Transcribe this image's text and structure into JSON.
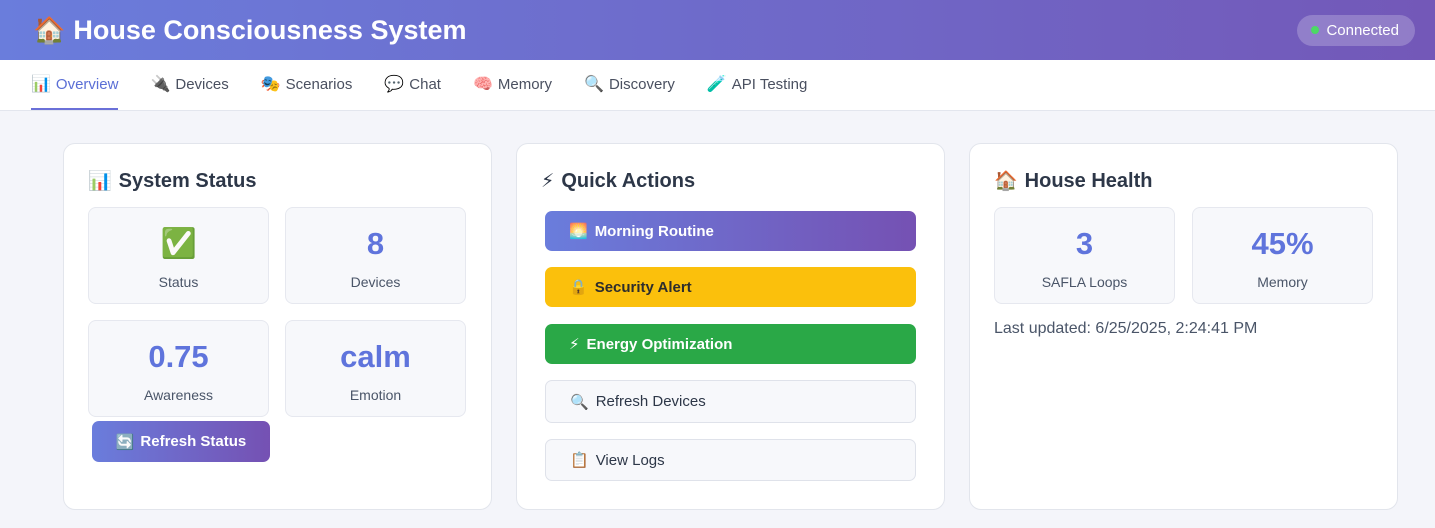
{
  "header": {
    "title": "House Consciousness System",
    "title_icon": "🏠",
    "connection": {
      "label": "Connected",
      "status_color": "#4cd964"
    }
  },
  "tabs": [
    {
      "icon": "📊",
      "label": "Overview",
      "active": true
    },
    {
      "icon": "🔌",
      "label": "Devices"
    },
    {
      "icon": "🎭",
      "label": "Scenarios"
    },
    {
      "icon": "💬",
      "label": "Chat"
    },
    {
      "icon": "🧠",
      "label": "Memory"
    },
    {
      "icon": "🔍",
      "label": "Discovery"
    },
    {
      "icon": "🧪",
      "label": "API Testing"
    }
  ],
  "system_status": {
    "icon": "📊",
    "title": "System Status",
    "stats": [
      {
        "value": "✅",
        "label": "Status"
      },
      {
        "value": "8",
        "label": "Devices"
      },
      {
        "value": "0.75",
        "label": "Awareness"
      },
      {
        "value": "calm",
        "label": "Emotion"
      }
    ],
    "refresh_button": {
      "icon": "🔄",
      "label": "Refresh Status"
    }
  },
  "quick_actions": {
    "icon": "⚡",
    "title": "Quick Actions",
    "buttons": [
      {
        "icon": "🌅",
        "label": "Morning Routine"
      },
      {
        "icon": "🔒",
        "label": "Security Alert"
      },
      {
        "icon": "⚡",
        "label": "Energy Optimization"
      },
      {
        "icon": "🔍",
        "label": "Refresh Devices"
      },
      {
        "icon": "📋",
        "label": "View Logs"
      }
    ]
  },
  "house_health": {
    "icon": "🏠",
    "title": "House Health",
    "stats": [
      {
        "value": "3",
        "label": "SAFLA Loops"
      },
      {
        "value": "45%",
        "label": "Memory"
      }
    ],
    "last_updated": "Last updated: 6/25/2025, 2:24:41 PM"
  },
  "colors": {
    "accent": "#5f74dc",
    "header_gradient_start": "#6a7ddc",
    "header_gradient_end": "#7358b8",
    "warning": "#fbc00c",
    "success": "#2aa847"
  }
}
